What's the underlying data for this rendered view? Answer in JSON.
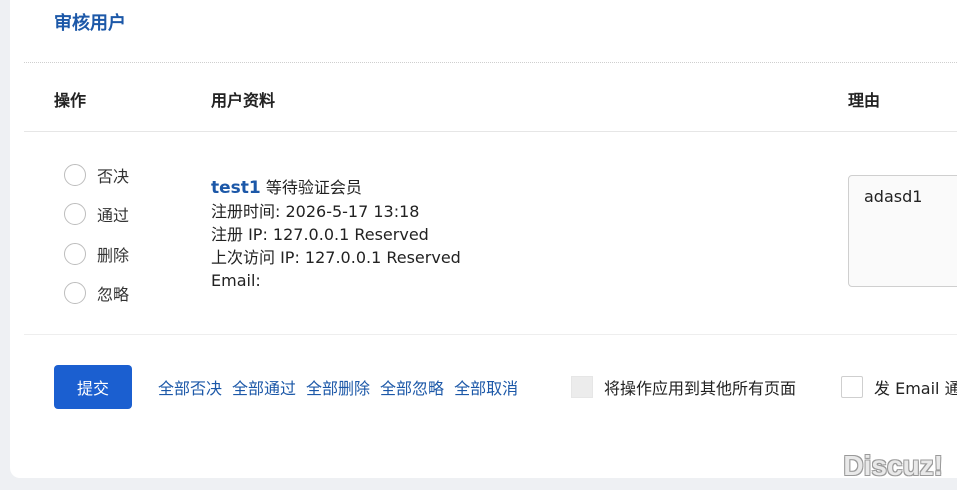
{
  "title": "审核用户",
  "columns": {
    "action": "操作",
    "profile": "用户资料",
    "reason": "理由"
  },
  "actions": [
    "否决",
    "通过",
    "删除",
    "忽略"
  ],
  "user": {
    "name": "test1",
    "status": "等待验证会员",
    "reg_time": "注册时间: 2026-5-17 13:18",
    "reg_ip": "注册 IP: 127.0.0.1 Reserved",
    "last_ip": "上次访问 IP: 127.0.0.1 Reserved",
    "email": "Email:"
  },
  "reason_value": "adasd1",
  "submit_label": "提交",
  "bulk_links": [
    "全部否决",
    "全部通过",
    "全部删除",
    "全部忽略",
    "全部取消"
  ],
  "apply_all_label": "将操作应用到其他所有页面",
  "send_email_label": "发 Email 通知",
  "watermark": "Discuz!"
}
